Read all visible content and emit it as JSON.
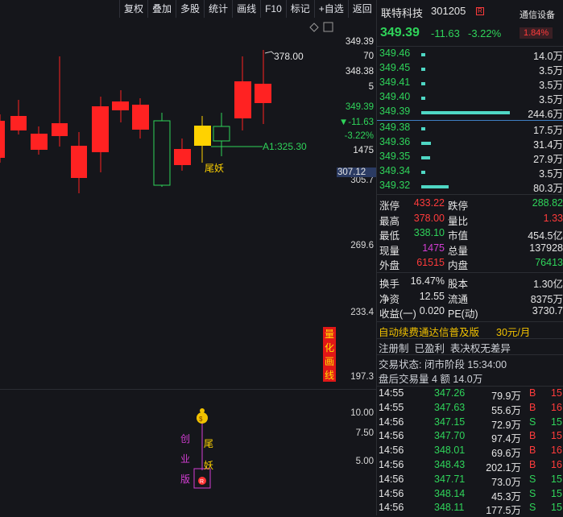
{
  "toolbar": [
    "复权",
    "叠加",
    "多股",
    "统计",
    "画线",
    "F10",
    "标记",
    "+自选",
    "返回"
  ],
  "chart": {
    "high_marker": "378.00",
    "a1_label": "A1:325.30",
    "pattern_label": "尾妖",
    "side_tag": [
      "量",
      "化",
      "画",
      "线"
    ],
    "lower_left_tag": [
      "创",
      "业",
      "版"
    ],
    "lower_mid_tag": [
      "尾",
      "妖"
    ]
  },
  "price_axis": {
    "labels": [
      "349.39",
      "70",
      "348.38",
      "5",
      "349.39",
      "▼-11.63",
      "-3.22%",
      "1475",
      "305.7",
      "269.6",
      "233.4",
      "197.3"
    ],
    "current_badge": "307.12",
    "lower_labels": [
      "10.00",
      "7.50",
      "5.00"
    ]
  },
  "stock": {
    "name": "联特科技",
    "code": "301205",
    "badge": "R",
    "price": "349.39",
    "change": "-11.63",
    "change_pct": "-3.22%",
    "sector": "通信设备",
    "sector_pct": "1.84%"
  },
  "order_book": {
    "asks": [
      {
        "price": "349.46",
        "vol": "14.0万",
        "bar": 0.03
      },
      {
        "price": "349.45",
        "vol": "3.5万",
        "bar": 0.01
      },
      {
        "price": "349.41",
        "vol": "3.5万",
        "bar": 0.01
      },
      {
        "price": "349.40",
        "vol": "3.5万",
        "bar": 0.01
      },
      {
        "price": "349.39",
        "vol": "244.6万",
        "bar": 1.0
      }
    ],
    "bids": [
      {
        "price": "349.38",
        "vol": "17.5万",
        "bar": 0.03
      },
      {
        "price": "349.36",
        "vol": "31.4万",
        "bar": 0.11
      },
      {
        "price": "349.35",
        "vol": "27.9万",
        "bar": 0.1
      },
      {
        "price": "349.34",
        "vol": "3.5万",
        "bar": 0.01
      },
      {
        "price": "349.32",
        "vol": "80.3万",
        "bar": 0.31
      }
    ]
  },
  "quote": [
    {
      "l1": "涨停",
      "v1": "433.22",
      "c1": "red",
      "l2": "跌停",
      "v2": "288.82",
      "c2": "green"
    },
    {
      "l1": "最高",
      "v1": "378.00",
      "c1": "red",
      "l2": "量比",
      "v2": "1.33",
      "c2": "red"
    },
    {
      "l1": "最低",
      "v1": "338.10",
      "c1": "green",
      "l2": "市值",
      "v2": "454.5亿",
      "c2": "white"
    },
    {
      "l1": "现量",
      "v1": "1475",
      "c1": "purple",
      "l2": "总量",
      "v2": "137928",
      "c2": "white"
    },
    {
      "l1": "外盘",
      "v1": "61515",
      "c1": "red",
      "l2": "内盘",
      "v2": "76413",
      "c2": "green"
    }
  ],
  "finance": [
    {
      "l1": "换手",
      "v1": "16.47%",
      "l2": "股本",
      "v2": "1.30亿"
    },
    {
      "l1": "净资",
      "v1": "12.55",
      "l2": "流通",
      "v2": "8375万"
    },
    {
      "l1": "收益(一)",
      "v1": "0.020",
      "l2": "PE(动)",
      "v2": "3730.7"
    }
  ],
  "promo": {
    "text": "自动续费通达信普及版",
    "price": "30元/月"
  },
  "tags_line": "注册制  已盈利  表决权无差异",
  "status": {
    "state": "交易状态: 闭市阶段 15:34:00",
    "after_hours": "盘后交易量 4 额 14.0万"
  },
  "trades": [
    {
      "time": "14:55",
      "price": "347.26",
      "vol": "79.9万",
      "side": "B",
      "n": "15"
    },
    {
      "time": "14:55",
      "price": "347.63",
      "vol": "55.6万",
      "side": "B",
      "n": "16"
    },
    {
      "time": "14:56",
      "price": "347.15",
      "vol": "72.9万",
      "side": "S",
      "n": "15"
    },
    {
      "time": "14:56",
      "price": "347.70",
      "vol": "97.4万",
      "side": "B",
      "n": "15"
    },
    {
      "time": "14:56",
      "price": "348.01",
      "vol": "69.6万",
      "side": "B",
      "n": "16"
    },
    {
      "time": "14:56",
      "price": "348.43",
      "vol": "202.1万",
      "side": "B",
      "n": "16"
    },
    {
      "time": "14:56",
      "price": "347.71",
      "vol": "73.0万",
      "side": "S",
      "n": "15"
    },
    {
      "time": "14:56",
      "price": "348.14",
      "vol": "45.3万",
      "side": "S",
      "n": "15"
    },
    {
      "time": "14:56",
      "price": "348.11",
      "vol": "177.5万",
      "side": "S",
      "n": "15"
    }
  ],
  "colors": {
    "up": "#ff2222",
    "down": "#2fd45a",
    "ma": "#4fd7c4",
    "accent": "#ffd200"
  }
}
